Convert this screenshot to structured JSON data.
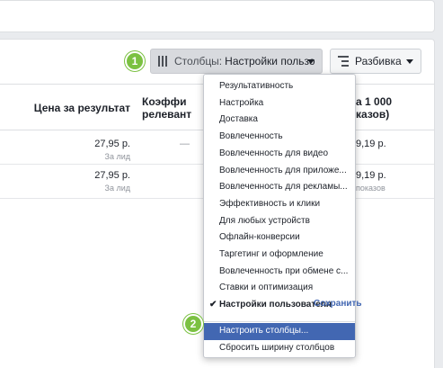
{
  "toolbar": {
    "step1": "1",
    "columns_prefix": "Столбцы:",
    "columns_value": "Настройки пользо",
    "breakdown_label": "Разбивка"
  },
  "table": {
    "headers": {
      "cost_per_result": "Цена за результат",
      "relevance_line1": "Коэффи",
      "relevance_line2": "релевант",
      "cpm_line1": "а 1 000",
      "cpm_line2": "казов)"
    },
    "rows": [
      {
        "cost": "27,95 р.",
        "cost_sub": "За лид",
        "relevance": "—",
        "cpm": "9,19 р.",
        "cpm_sub": ""
      },
      {
        "cost": "27,95 р.",
        "cost_sub": "За лид",
        "relevance": "",
        "cpm": "9,19 р.",
        "cpm_sub": "показов"
      }
    ]
  },
  "menu": {
    "items": [
      {
        "label": "Результативность"
      },
      {
        "label": "Настройка"
      },
      {
        "label": "Доставка"
      },
      {
        "label": "Вовлеченность"
      },
      {
        "label": "Вовлеченность для видео"
      },
      {
        "label": "Вовлеченность для приложе..."
      },
      {
        "label": "Вовлеченность для рекламы..."
      },
      {
        "label": "Эффективность и клики"
      },
      {
        "label": "Для любых устройств"
      },
      {
        "label": "Офлайн-конверсии"
      },
      {
        "label": "Таргетинг и оформление"
      },
      {
        "label": "Вовлеченность при обмене с..."
      },
      {
        "label": "Ставки и оптимизация"
      },
      {
        "label": "Настройки пользователя",
        "check": "✔"
      }
    ],
    "save_label": "Сохранить",
    "step2": "2",
    "customize_label": "Настроить столбцы...",
    "reset_label": "Сбросить ширину столбцов"
  },
  "colors": {
    "accent": "#4267b2",
    "badge": "#7bc142",
    "page_bg": "#e9ebee"
  },
  "icons": [
    "columns-icon",
    "breakdown-icon",
    "caret-down-icon",
    "check-icon"
  ]
}
